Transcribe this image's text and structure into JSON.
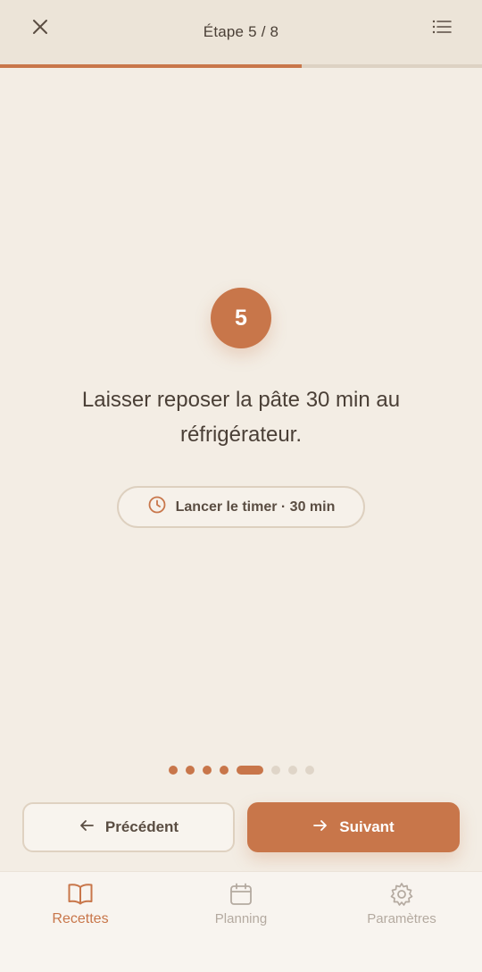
{
  "header": {
    "title": "Étape 5 / 8",
    "close_icon": "close-icon",
    "steps_icon": "list-icon"
  },
  "progress": {
    "current_step": 5,
    "total_steps": 8,
    "fraction": 0.625
  },
  "step": {
    "number": "5",
    "instruction": "Laisser reposer la pâte 30 min au réfrigérateur.",
    "timer_label": "Lancer le timer · 30 min",
    "timer_icon": "clock-icon"
  },
  "pagination": {
    "total": 8,
    "current": 5
  },
  "navigation": {
    "prev_label": "Précédent",
    "next_label": "Suivant",
    "prev_icon": "arrow-left-icon",
    "next_icon": "arrow-right-icon"
  },
  "tabs": [
    {
      "label": "Recettes",
      "icon": "book-icon",
      "active": true
    },
    {
      "label": "Planning",
      "icon": "calendar-icon",
      "active": false
    },
    {
      "label": "Paramètres",
      "icon": "gear-icon",
      "active": false
    }
  ],
  "colors": {
    "accent": "#c8764a",
    "background": "#f3ede4",
    "header": "#ece4d8",
    "text": "#4a3f36",
    "inactive": "#b4aaa0"
  }
}
